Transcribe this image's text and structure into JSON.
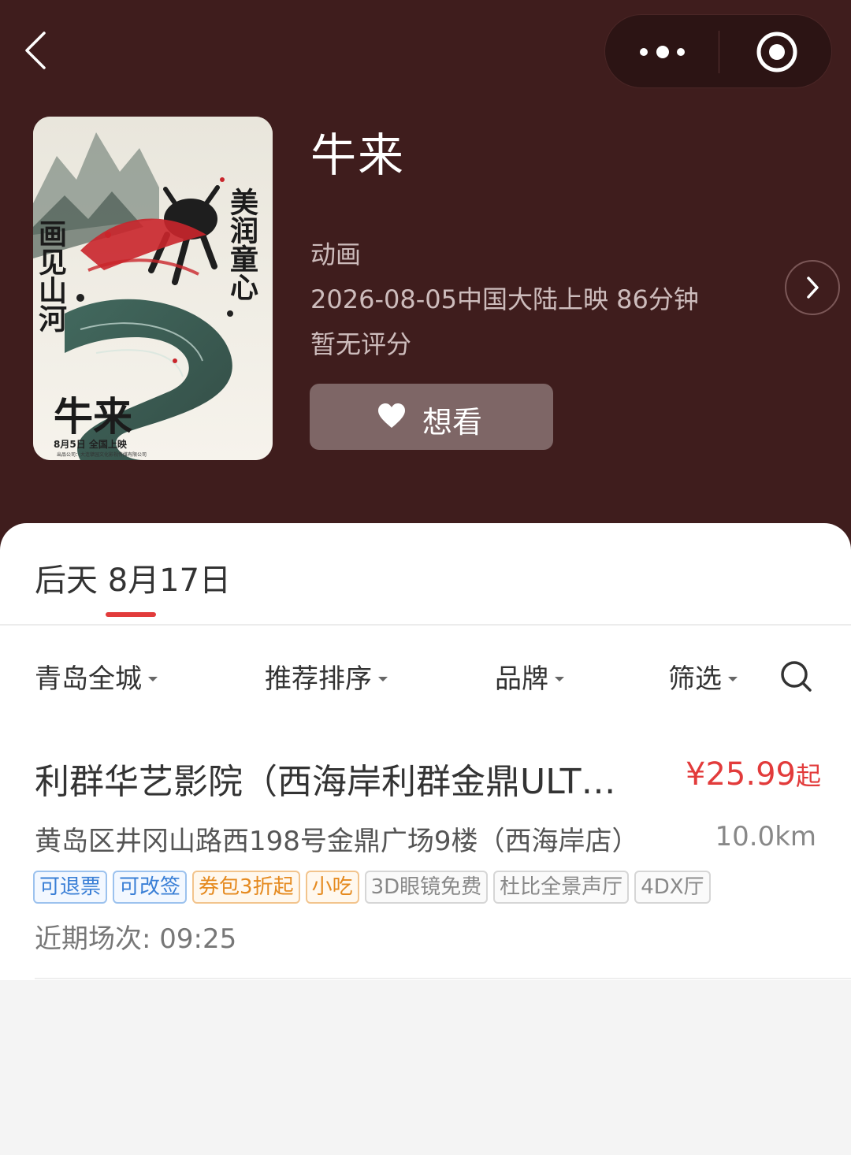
{
  "movie": {
    "title": "牛来",
    "genre": "动画",
    "release": "2026-08-05中国大陆上映 86分钟",
    "rating": "暂无评分",
    "want_label": "想看",
    "poster": {
      "title_text": "牛来",
      "slogan_left": "画见山河",
      "slogan_right": "美润童心",
      "date_text": "8月5日 全国上映",
      "credit_text": "出品公司：大连擘园文化影视传媒有限公司"
    }
  },
  "date_tab": {
    "label": "后天 8月17日"
  },
  "filters": {
    "city": "青岛全城",
    "sort": "推荐排序",
    "brand": "品牌",
    "filter": "筛选"
  },
  "cinema": {
    "name": "利群华艺影院（西海岸利群金鼎ULT…",
    "price": "¥25.99",
    "price_suffix": "起",
    "address": "黄岛区井冈山路西198号金鼎广场9楼（西海岸店）",
    "distance": "10.0km",
    "tags": [
      {
        "label": "可退票",
        "style": "blue"
      },
      {
        "label": "可改签",
        "style": "blue"
      },
      {
        "label": "券包3折起",
        "style": "orange"
      },
      {
        "label": "小吃",
        "style": "orange"
      },
      {
        "label": "3D眼镜免费",
        "style": "gray"
      },
      {
        "label": "杜比全景声厅",
        "style": "gray"
      },
      {
        "label": "4DX厅",
        "style": "gray"
      }
    ],
    "showtimes": "近期场次: 09:25"
  },
  "colors": {
    "header_bg": "#3f1d1d",
    "accent": "#e23b3b",
    "tag_blue": "#3a7fd6",
    "tag_orange": "#e58a1f"
  }
}
